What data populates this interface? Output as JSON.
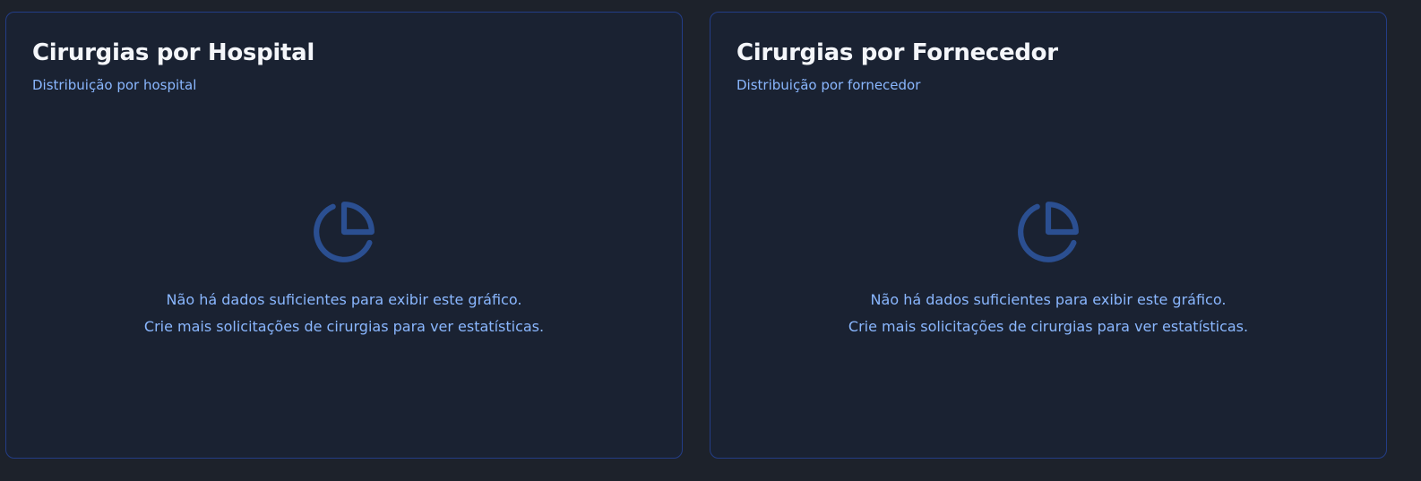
{
  "colors": {
    "page_background": "#1d222b",
    "card_background": "#1a2232",
    "card_border": "#233d86",
    "title": "#f4f6fa",
    "accent_text": "#8ab7ff",
    "icon": "#2b4f91"
  },
  "cards": [
    {
      "title": "Cirurgias por Hospital",
      "subtitle": "Distribuição por hospital",
      "icon": "pie-chart-icon",
      "empty_line_1": "Não há dados suficientes para exibir este gráfico.",
      "empty_line_2": "Crie mais solicitações de cirurgias para ver estatísticas."
    },
    {
      "title": "Cirurgias por Fornecedor",
      "subtitle": "Distribuição por fornecedor",
      "icon": "pie-chart-icon",
      "empty_line_1": "Não há dados suficientes para exibir este gráfico.",
      "empty_line_2": "Crie mais solicitações de cirurgias para ver estatísticas."
    }
  ]
}
